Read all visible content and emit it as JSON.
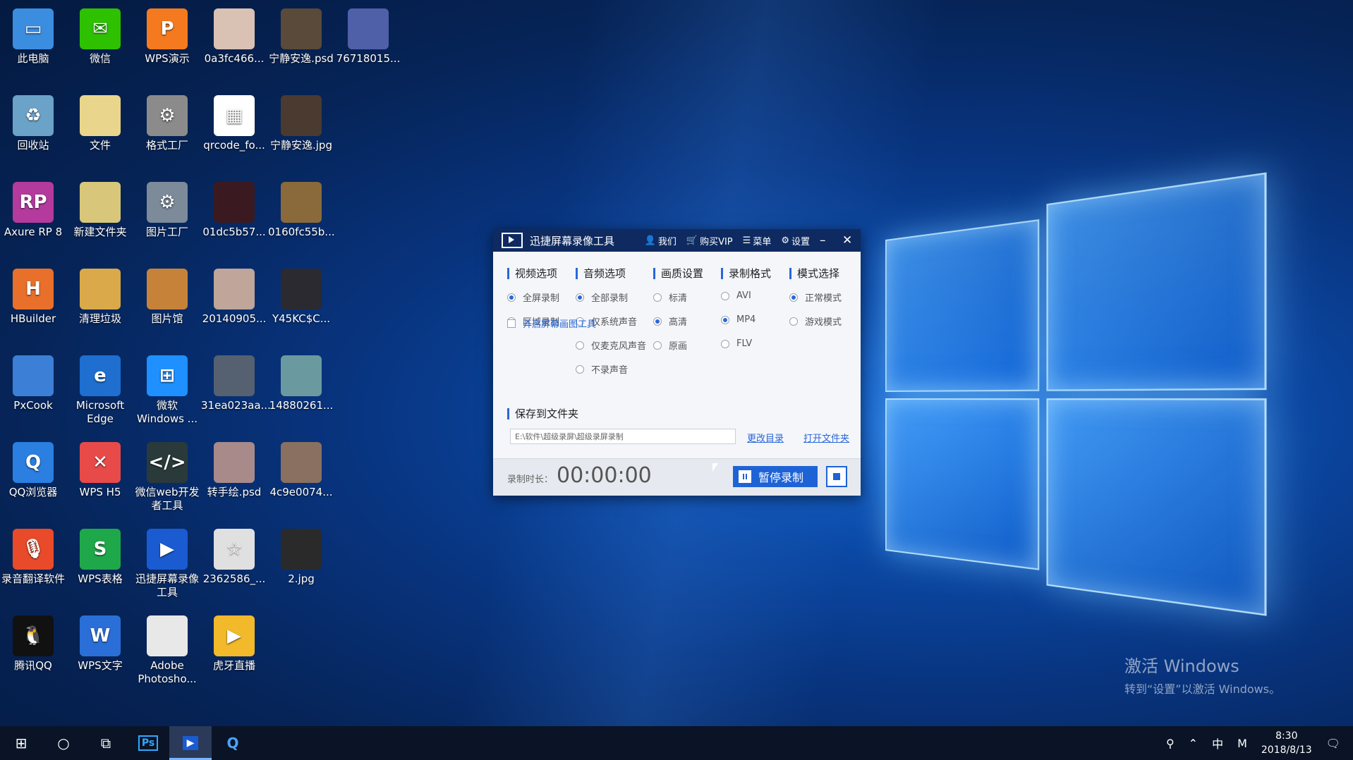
{
  "desktop_icons": [
    {
      "label": "此电脑",
      "col": 0,
      "row": 0,
      "color": "#3b8de0",
      "glyph": "▭",
      "icon": "computer-icon"
    },
    {
      "label": "微信",
      "col": 1,
      "row": 0,
      "color": "#2dc100",
      "glyph": "✉",
      "icon": "wechat-icon"
    },
    {
      "label": "WPS演示",
      "col": 2,
      "row": 0,
      "color": "#f57a1f",
      "glyph": "P",
      "icon": "wps-presentation-icon"
    },
    {
      "label": "0a3fc466...",
      "col": 3,
      "row": 0,
      "color": "#d9c2b3",
      "glyph": "",
      "icon": "image-file-icon"
    },
    {
      "label": "宁静安逸.psd",
      "col": 4,
      "row": 0,
      "color": "#5a4a3a",
      "glyph": "",
      "icon": "psd-file-icon"
    },
    {
      "label": "76718015...",
      "col": 5,
      "row": 0,
      "color": "#4f5fa8",
      "glyph": "",
      "icon": "image-file-icon"
    },
    {
      "label": "回收站",
      "col": 0,
      "row": 1,
      "color": "#6aa2c8",
      "glyph": "♻",
      "icon": "recycle-bin-icon"
    },
    {
      "label": "文件",
      "col": 1,
      "row": 1,
      "color": "#e9d58b",
      "glyph": "",
      "icon": "folder-icon"
    },
    {
      "label": "格式工厂",
      "col": 2,
      "row": 1,
      "color": "#8b8b8b",
      "glyph": "⚙",
      "icon": "format-factory-icon"
    },
    {
      "label": "qrcode_fo...",
      "col": 3,
      "row": 1,
      "color": "#ffffff",
      "glyph": "▦",
      "icon": "qrcode-image-icon"
    },
    {
      "label": "宁静安逸.jpg",
      "col": 4,
      "row": 1,
      "color": "#4a3a30",
      "glyph": "",
      "icon": "image-file-icon"
    },
    {
      "label": "Axure RP 8",
      "col": 0,
      "row": 2,
      "color": "#b53a9e",
      "glyph": "RP",
      "icon": "axure-icon"
    },
    {
      "label": "新建文件夹",
      "col": 1,
      "row": 2,
      "color": "#d8c77a",
      "glyph": "",
      "icon": "folder-icon"
    },
    {
      "label": "图片工厂",
      "col": 2,
      "row": 2,
      "color": "#7c8a9a",
      "glyph": "⚙",
      "icon": "picture-factory-icon"
    },
    {
      "label": "01dc5b57...",
      "col": 3,
      "row": 2,
      "color": "#3a1a20",
      "glyph": "",
      "icon": "image-file-icon"
    },
    {
      "label": "0160fc55b...",
      "col": 4,
      "row": 2,
      "color": "#8a6a3a",
      "glyph": "",
      "icon": "image-file-icon"
    },
    {
      "label": "HBuilder",
      "col": 0,
      "row": 3,
      "color": "#e8702a",
      "glyph": "H",
      "icon": "hbuilder-icon"
    },
    {
      "label": "清理垃圾",
      "col": 1,
      "row": 3,
      "color": "#d9a94a",
      "glyph": "",
      "icon": "cleanup-icon"
    },
    {
      "label": "图片馆",
      "col": 2,
      "row": 3,
      "color": "#c7823a",
      "glyph": "",
      "icon": "picture-gallery-icon"
    },
    {
      "label": "20140905...",
      "col": 3,
      "row": 3,
      "color": "#bfa59a",
      "glyph": "",
      "icon": "image-file-icon"
    },
    {
      "label": "Y45KC$C...",
      "col": 4,
      "row": 3,
      "color": "#2a2a30",
      "glyph": "",
      "icon": "image-file-icon"
    },
    {
      "label": "PxCook",
      "col": 0,
      "row": 4,
      "color": "#3c7fd6",
      "glyph": "",
      "icon": "pxcook-icon"
    },
    {
      "label": "Microsoft Edge",
      "col": 1,
      "row": 4,
      "color": "#1e6fd0",
      "glyph": "e",
      "icon": "edge-icon"
    },
    {
      "label": "微软 Windows ...",
      "col": 2,
      "row": 4,
      "color": "#1e90ff",
      "glyph": "⊞",
      "icon": "windows-icon"
    },
    {
      "label": "31ea023aa...",
      "col": 3,
      "row": 4,
      "color": "#556070",
      "glyph": "",
      "icon": "image-file-icon"
    },
    {
      "label": "14880261...",
      "col": 4,
      "row": 4,
      "color": "#6a9aa0",
      "glyph": "",
      "icon": "image-file-icon"
    },
    {
      "label": "QQ浏览器",
      "col": 0,
      "row": 5,
      "color": "#2a7fe0",
      "glyph": "Q",
      "icon": "qq-browser-icon"
    },
    {
      "label": "WPS H5",
      "col": 1,
      "row": 5,
      "color": "#e84a4a",
      "glyph": "✕",
      "icon": "wps-h5-icon"
    },
    {
      "label": "微信web开发者工具",
      "col": 2,
      "row": 5,
      "color": "#2a3a3a",
      "glyph": "</>",
      "icon": "wechat-devtools-icon"
    },
    {
      "label": "转手绘.psd",
      "col": 3,
      "row": 5,
      "color": "#a88a8a",
      "glyph": "",
      "icon": "psd-file-icon"
    },
    {
      "label": "4c9e0074...",
      "col": 4,
      "row": 5,
      "color": "#8a7060",
      "glyph": "",
      "icon": "image-file-icon"
    },
    {
      "label": "录音翻译软件",
      "col": 0,
      "row": 6,
      "color": "#e84a2a",
      "glyph": "🎙",
      "icon": "recorder-translate-icon"
    },
    {
      "label": "WPS表格",
      "col": 1,
      "row": 6,
      "color": "#1fa84a",
      "glyph": "S",
      "icon": "wps-spreadsheet-icon"
    },
    {
      "label": "迅捷屏幕录像工具",
      "col": 2,
      "row": 6,
      "color": "#1a5bd1",
      "glyph": "▶",
      "icon": "screen-recorder-icon"
    },
    {
      "label": "2362586_...",
      "col": 3,
      "row": 6,
      "color": "#e0e0e0",
      "glyph": "☆",
      "icon": "image-file-icon"
    },
    {
      "label": "2.jpg",
      "col": 4,
      "row": 6,
      "color": "#2a2a2a",
      "glyph": "",
      "icon": "image-file-icon"
    },
    {
      "label": "腾讯QQ",
      "col": 0,
      "row": 7,
      "color": "#111111",
      "glyph": "🐧",
      "icon": "qq-icon"
    },
    {
      "label": "WPS文字",
      "col": 1,
      "row": 7,
      "color": "#2a6fd8",
      "glyph": "W",
      "icon": "wps-writer-icon"
    },
    {
      "label": "Adobe Photosho...",
      "col": 2,
      "row": 7,
      "color": "#e8e8e8",
      "glyph": "",
      "icon": "photoshop-file-icon"
    },
    {
      "label": "虎牙直播",
      "col": 3,
      "row": 7,
      "color": "#f2b92a",
      "glyph": "▶",
      "icon": "huya-icon"
    }
  ],
  "recorder": {
    "title": "迅捷屏幕录像工具",
    "tools": {
      "about": "我们",
      "vip": "购买VIP",
      "menu": "菜单",
      "settings": "设置"
    },
    "sections": {
      "video": {
        "head": "视频选项",
        "options": [
          {
            "label": "全屏录制",
            "on": true
          },
          {
            "label": "区域录制",
            "on": false
          }
        ]
      },
      "audio": {
        "head": "音频选项",
        "options": [
          {
            "label": "全部录制",
            "on": true
          },
          {
            "label": "仅系统声音",
            "on": false
          },
          {
            "label": "仅麦克风声音",
            "on": false
          },
          {
            "label": "不录声音",
            "on": false
          }
        ]
      },
      "quality": {
        "head": "画质设置",
        "options": [
          {
            "label": "标清",
            "on": false
          },
          {
            "label": "高清",
            "on": true
          },
          {
            "label": "原画",
            "on": false
          }
        ]
      },
      "format": {
        "head": "录制格式",
        "options": [
          {
            "label": "AVI",
            "on": false
          },
          {
            "label": "MP4",
            "on": true
          },
          {
            "label": "FLV",
            "on": false
          }
        ]
      },
      "mode": {
        "head": "模式选择",
        "options": [
          {
            "label": "正常模式",
            "on": true
          },
          {
            "label": "游戏模式",
            "on": false
          }
        ]
      }
    },
    "screen_tool": "开启屏幕画图工具",
    "save_head": "保存到文件夹",
    "path": "E:\\软件\\超级录屏\\超级录屏录制",
    "change_dir": "更改目录",
    "open_folder": "打开文件夹",
    "duration_label": "录制时长：",
    "duration": "00:00:00",
    "pause_label": "暂停录制"
  },
  "activate": {
    "line1": "激活 Windows",
    "line2": "转到“设置”以激活 Windows。"
  },
  "taskbar": {
    "time": "8:30",
    "date": "2018/8/13",
    "ime": "中",
    "ime2": "M"
  },
  "colors": {
    "accent": "#1e63d6",
    "titlebar": "#0e2a61"
  }
}
